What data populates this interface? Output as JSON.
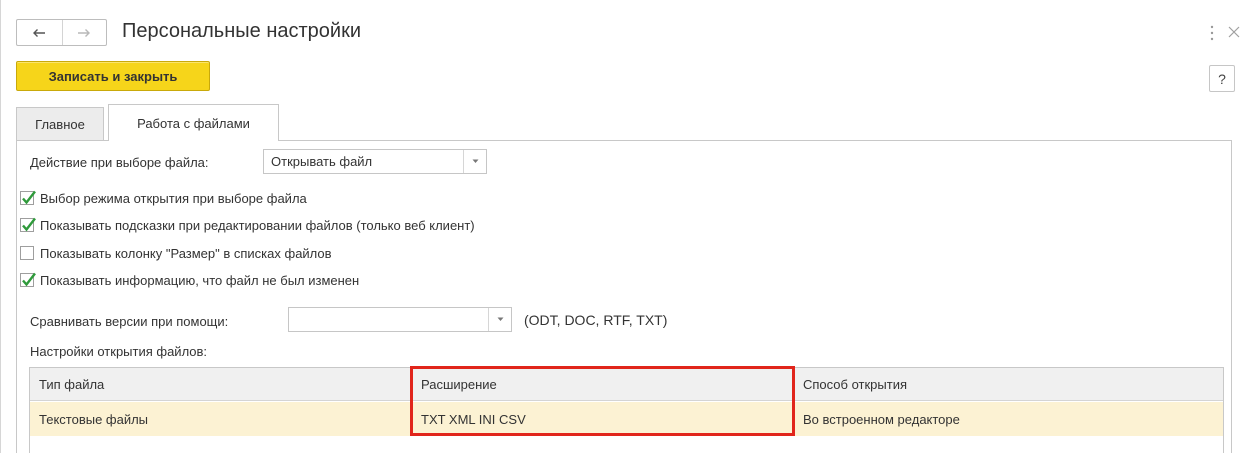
{
  "window": {
    "title": "Персональные настройки"
  },
  "toolbar": {
    "save_close_label": "Записать и закрыть",
    "help_label": "?"
  },
  "tabs": [
    {
      "label": "Главное",
      "active": false
    },
    {
      "label": "Работа с файлами",
      "active": true
    }
  ],
  "form": {
    "file_action_label": "Действие при выборе файла:",
    "file_action_value": "Открывать файл",
    "checkboxes": [
      {
        "label": "Выбор режима открытия при выборе файла",
        "checked": true
      },
      {
        "label": "Показывать подсказки при редактировании файлов (только веб клиент)",
        "checked": true
      },
      {
        "label": "Показывать колонку \"Размер\" в списках файлов",
        "checked": false
      },
      {
        "label": "Показывать информацию, что файл не был изменен",
        "checked": true
      }
    ],
    "compare_label": "Сравнивать версии при помощи:",
    "compare_value": "",
    "compare_formats": "(ODT, DOC, RTF, TXT)",
    "open_settings_label": "Настройки открытия файлов:"
  },
  "table": {
    "columns": [
      "Тип файла",
      "Расширение",
      "Способ открытия"
    ],
    "rows": [
      [
        "Текстовые файлы",
        "TXT XML INI CSV",
        "Во встроенном редакторе"
      ]
    ]
  },
  "colors": {
    "accent_button": "#f6d51a",
    "selected_row": "#fcf2d3",
    "highlight_frame": "#e1251b"
  }
}
